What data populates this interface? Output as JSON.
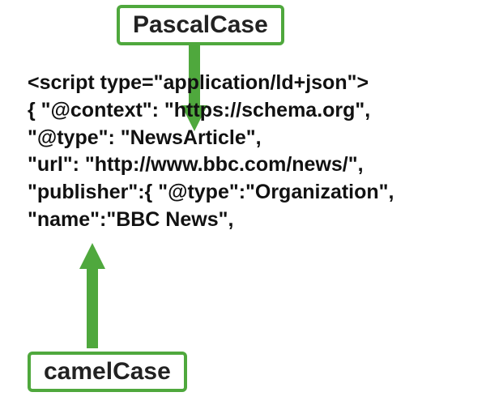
{
  "labels": {
    "top": "PascalCase",
    "bottom": "camelCase"
  },
  "code": {
    "line1": "<script type=\"application/ld+json\">",
    "line2": "{ \"@context\": \"https://schema.org\",",
    "line3": "\"@type\": \"NewsArticle\",",
    "line4": "\"url\": \"http://www.bbc.com/news/\",",
    "line5": "\"publisher\":{ \"@type\":\"Organization\",",
    "line6": "\"name\":\"BBC News\","
  },
  "arrows": {
    "top_target": "NewsArticle (PascalCase type value)",
    "bottom_target": "name (camelCase property key)"
  }
}
